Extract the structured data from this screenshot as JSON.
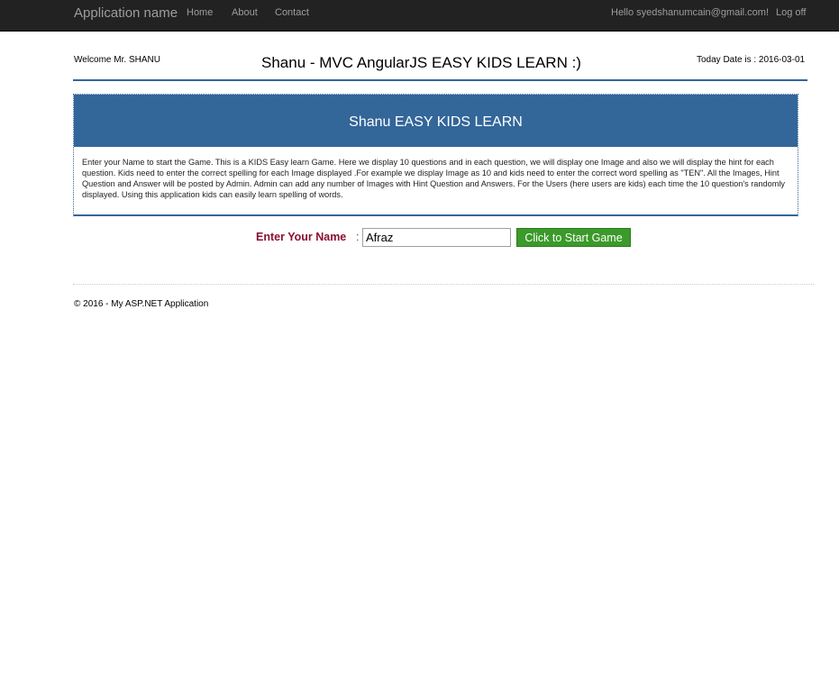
{
  "navbar": {
    "brand": "Application name",
    "links": [
      "Home",
      "About",
      "Contact"
    ],
    "hello": "Hello syedshanumcain@gmail.com!",
    "logoff": "Log off"
  },
  "header": {
    "welcome": "Welcome Mr. SHANU",
    "title": "Shanu - MVC AngularJS EASY KIDS LEARN :)",
    "today": "Today Date is : 2016-03-01"
  },
  "panel": {
    "title": "Shanu EASY KIDS LEARN",
    "description": "Enter your Name to start the Game. This is a KIDS Easy learn Game. Here we display 10 questions and in each question, we will display one Image and also we will display the hint for each question. Kids need to enter the correct spelling for each Image displayed .For example we display Image as 10 and kids need to enter the correct word spelling as \"TEN\". All the Images, Hint Question and Answer will be posted by Admin. Admin can add any number of Images with Hint Question and Answers. For the Users (here users are kids) each time the 10 question's randomly displayed. Using this application kids can easily learn spelling of words."
  },
  "form": {
    "name_label": "Enter Your Name",
    "colon": ":",
    "name_value": "Afraz",
    "start_button": "Click to Start Game"
  },
  "footer": {
    "text": "© 2016 - My ASP.NET Application"
  },
  "colors": {
    "navbar": "#222222",
    "accent": "#336699",
    "label": "#8a1230",
    "button": "#3b9a2a"
  }
}
